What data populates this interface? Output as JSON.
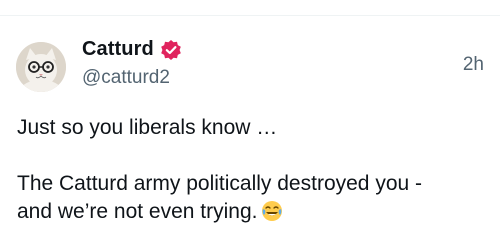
{
  "tweet": {
    "display_name": "Catturd",
    "handle": "@catturd2",
    "timestamp": "2h",
    "line1": "Just so you liberals know …",
    "line2": "The Catturd army politically destroyed you -",
    "line3": "and we’re not even trying.",
    "emoji": "joy-emoji-icon",
    "verified_icon": "verified-badge-icon",
    "verified_color": "#e0245e"
  }
}
